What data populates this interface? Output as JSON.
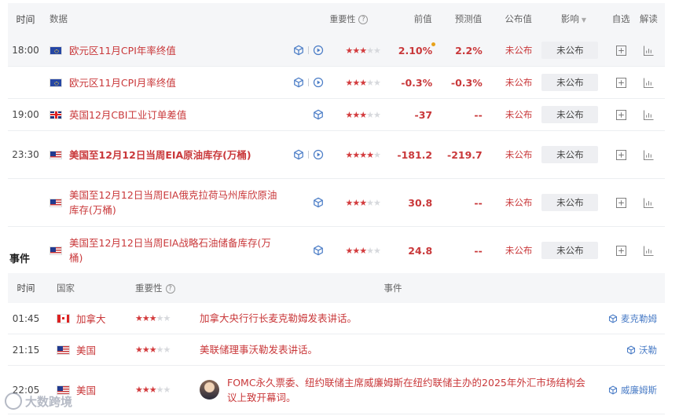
{
  "header": {
    "time": "时间",
    "data": "数据",
    "importance": "重要性",
    "previous": "前值",
    "forecast": "预测值",
    "published": "公布值",
    "effect": "影响",
    "favorite": "自选",
    "analysis": "解读"
  },
  "data_rows": [
    {
      "time": "18:00",
      "flag": "eu",
      "label": "欧元区11月CPI年率终值",
      "bold": false,
      "icons": [
        "cube-icon",
        "play-icon"
      ],
      "stars": 3,
      "previous": "2.10%",
      "previous_dot": true,
      "forecast": "2.2%",
      "published": "未公布",
      "effect": "未公布",
      "highlight": true
    },
    {
      "time": "",
      "flag": "eu",
      "label": "欧元区11月CPI月率终值",
      "bold": false,
      "icons": [
        "cube-icon",
        "play-icon"
      ],
      "stars": 3,
      "previous": "-0.3%",
      "previous_dot": false,
      "forecast": "-0.3%",
      "published": "未公布",
      "effect": "未公布",
      "highlight": false
    },
    {
      "time": "19:00",
      "flag": "uk",
      "label": "英国12月CBI工业订单差值",
      "bold": false,
      "icons": [
        "cube-icon"
      ],
      "stars": 3,
      "previous": "-37",
      "previous_dot": false,
      "forecast": "--",
      "published": "未公布",
      "effect": "未公布",
      "highlight": false
    },
    {
      "time": "23:30",
      "flag": "us",
      "label": "美国至12月12日当周EIA原油库存(万桶)",
      "bold": true,
      "icons": [
        "cube-icon",
        "play-icon"
      ],
      "stars": 4,
      "previous": "-181.2",
      "previous_dot": false,
      "forecast": "-219.7",
      "published": "未公布",
      "effect": "未公布",
      "highlight": false
    },
    {
      "time": "",
      "flag": "us",
      "label": "美国至12月12日当周EIA俄克拉荷马州库欣原油库存(万桶)",
      "bold": false,
      "icons": [
        "cube-icon"
      ],
      "stars": 3,
      "previous": "30.8",
      "previous_dot": false,
      "forecast": "--",
      "published": "未公布",
      "effect": "未公布",
      "highlight": false
    },
    {
      "time": "",
      "flag": "us",
      "label": "美国至12月12日当周EIA战略石油储备库存(万桶)",
      "bold": false,
      "icons": [
        "cube-icon"
      ],
      "stars": 3,
      "previous": "24.8",
      "previous_dot": false,
      "forecast": "--",
      "published": "未公布",
      "effect": "未公布",
      "highlight": false
    }
  ],
  "events_section": {
    "title": "事件",
    "header": {
      "time": "时间",
      "country": "国家",
      "importance": "重要性",
      "event": "事件"
    },
    "rows": [
      {
        "time": "01:45",
        "flag": "ca",
        "country": "加拿大",
        "stars": 3,
        "event": "加拿大央行行长麦克勒姆发表讲话。",
        "person": "麦克勒姆",
        "avatar": false
      },
      {
        "time": "21:15",
        "flag": "us",
        "country": "美国",
        "stars": 3,
        "event": "美联储理事沃勒发表讲话。",
        "person": "沃勒",
        "avatar": false
      },
      {
        "time": "22:05",
        "flag": "us",
        "country": "美国",
        "stars": 3,
        "event": "FOMC永久票委、纽约联储主席威廉姆斯在纽约联储主办的2025年外汇市场结构会议上致开幕词。",
        "person": "威廉姆斯",
        "avatar": true
      }
    ]
  },
  "watermark": "大数跨境",
  "colors": {
    "accent_red": "#c9383a",
    "link_blue": "#4a7cc6",
    "header_bg": "#f5f6f8"
  }
}
